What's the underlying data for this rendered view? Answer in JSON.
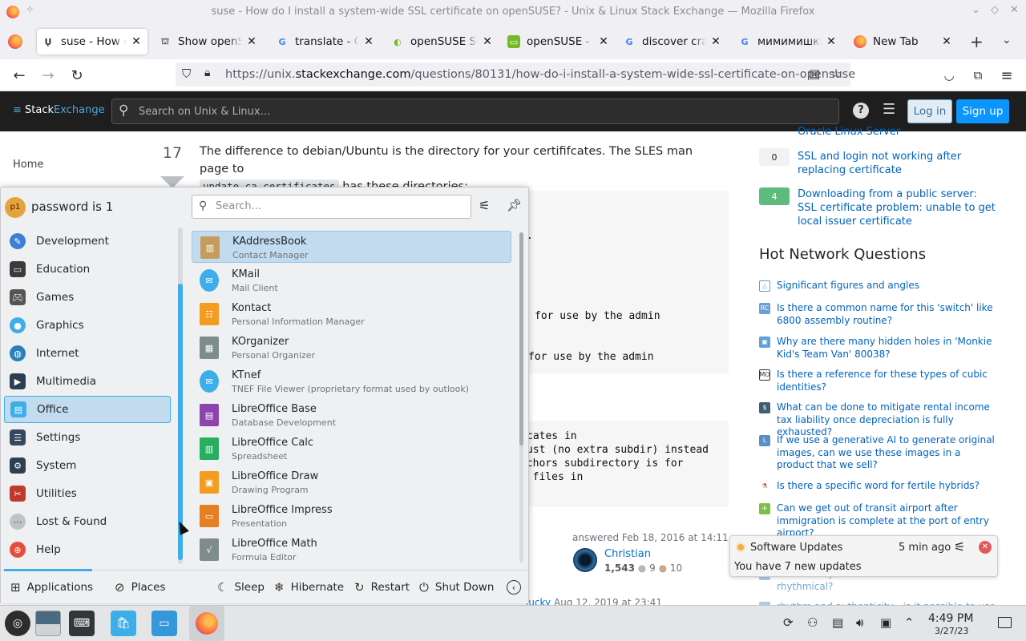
{
  "window": {
    "title": "suse - How do I install a system-wide SSL certificate on openSUSE? - Unix & Linux Stack Exchange — Mozilla Firefox"
  },
  "tabs": [
    {
      "label": "suse - How do I install a system-wide SSL certificate on openSUSE?",
      "active": true
    },
    {
      "label": "Show openSUSE"
    },
    {
      "label": "translate - Google"
    },
    {
      "label": "openSUSE Software"
    },
    {
      "label": "openSUSE - Linux"
    },
    {
      "label": "discover crash"
    },
    {
      "label": "мимимишки"
    },
    {
      "label": "New Tab"
    }
  ],
  "url": {
    "prefix": "https://unix.",
    "domain": "stackexchange.com",
    "path": "/questions/80131/how-do-i-install-a-system-wide-ssl-certificate-on-opensuse"
  },
  "site": {
    "logo_a": "Stack",
    "logo_b": "Exchange",
    "search_placeholder": "Search on Unix & Linux…",
    "login": "Log in",
    "signup": "Sign up"
  },
  "leftnav": {
    "home": "Home"
  },
  "answer": {
    "votes": "17",
    "text1": "The difference to debian/Ubuntu is the directory for your certififcates. The SLES man page to",
    "code1": "update-ca-certificates",
    "text2": "has these directories:",
    "pre1": [
      ".",
      "for use by the admin",
      "for use by the admin"
    ],
    "pre2": [
      "cates in",
      "ust (no extra subdir) instead",
      "nchors subdirectory is for",
      "m files in"
    ],
    "answered": "answered Feb 18, 2016 at 14:11",
    "user": "Christian",
    "rep": "1,543",
    "silver": "9",
    "bronze": "10",
    "bottom_user": "lucky",
    "bottom_date": "Aug 12, 2019 at 23:41"
  },
  "related": [
    {
      "count": "",
      "title": "Oracle Linux Server"
    },
    {
      "count": "0",
      "title": "SSL and login not working after replacing certificate",
      "answered": false
    },
    {
      "count": "4",
      "title": "Downloading from a public server: SSL certificate problem: unable to get local issuer certificate",
      "answered": true
    }
  ],
  "hnq": {
    "title": "Hot Network Questions",
    "items": [
      "Significant figures and angles",
      "Is there a common name for this 'switch' like 6800 assembly routine?",
      "Why are there many hidden holes in 'Monkie Kid's Team Van' 80038?",
      "Is there a reference for these types of cubic identities?",
      "What can be done to mitigate rental income tax liability once depreciation is fully exhausted?",
      "If we use a generative AI to generate original images, can we use these images in a product that we sell?",
      "Is there a specific word for fertile hybrids?",
      "Can we get out of transit airport after immigration is complete at the port of entry airport?",
      "Is there any unusual musicians are not rhythmical?",
      "rhythm and authenticity - is it possible to use"
    ]
  },
  "launcher": {
    "user": "password is 1",
    "avatar_initials": "p1",
    "search_placeholder": "Search...",
    "categories": [
      {
        "name": "Development",
        "icon": "development-icon"
      },
      {
        "name": "Education",
        "icon": "education-icon"
      },
      {
        "name": "Games",
        "icon": "games-icon"
      },
      {
        "name": "Graphics",
        "icon": "graphics-icon"
      },
      {
        "name": "Internet",
        "icon": "internet-icon"
      },
      {
        "name": "Multimedia",
        "icon": "multimedia-icon"
      },
      {
        "name": "Office",
        "icon": "office-icon",
        "selected": true
      },
      {
        "name": "Settings",
        "icon": "settings-icon"
      },
      {
        "name": "System",
        "icon": "system-icon"
      },
      {
        "name": "Utilities",
        "icon": "utilities-icon"
      },
      {
        "name": "Lost & Found",
        "icon": "lost-found-icon"
      },
      {
        "name": "Help",
        "icon": "help-icon"
      }
    ],
    "apps": [
      {
        "name": "KAddressBook",
        "desc": "Contact Manager",
        "selected": true,
        "color": "#c69c5d"
      },
      {
        "name": "KMail",
        "desc": "Mail Client",
        "color": "#3daee9"
      },
      {
        "name": "Kontact",
        "desc": "Personal Information Manager",
        "color": "#f39c1f"
      },
      {
        "name": "KOrganizer",
        "desc": "Personal Organizer",
        "color": "#7f8c8d"
      },
      {
        "name": "KTnef",
        "desc": "TNEF File Viewer (proprietary format used by outlook)",
        "color": "#3daee9"
      },
      {
        "name": "LibreOffice Base",
        "desc": "Database Development",
        "color": "#8e44ad"
      },
      {
        "name": "LibreOffice Calc",
        "desc": "Spreadsheet",
        "color": "#27ae60"
      },
      {
        "name": "LibreOffice Draw",
        "desc": "Drawing Program",
        "color": "#f39c1f"
      },
      {
        "name": "LibreOffice Impress",
        "desc": "Presentation",
        "color": "#e67e22"
      },
      {
        "name": "LibreOffice Math",
        "desc": "Formula Editor",
        "color": "#7f8c8d"
      }
    ],
    "footer": {
      "applications": "Applications",
      "places": "Places",
      "sleep": "Sleep",
      "hibernate": "Hibernate",
      "restart": "Restart",
      "shutdown": "Shut Down"
    }
  },
  "notification": {
    "title": "Software Updates",
    "time": "5 min ago",
    "body": "You have 7 new updates"
  },
  "clock": {
    "time": "4:49 PM",
    "date": "3/27/23"
  },
  "colors": {
    "accent": "#3daee9",
    "se_blue": "#0a95ff",
    "link": "#0063bf",
    "answered_green": "#5eba7d"
  }
}
